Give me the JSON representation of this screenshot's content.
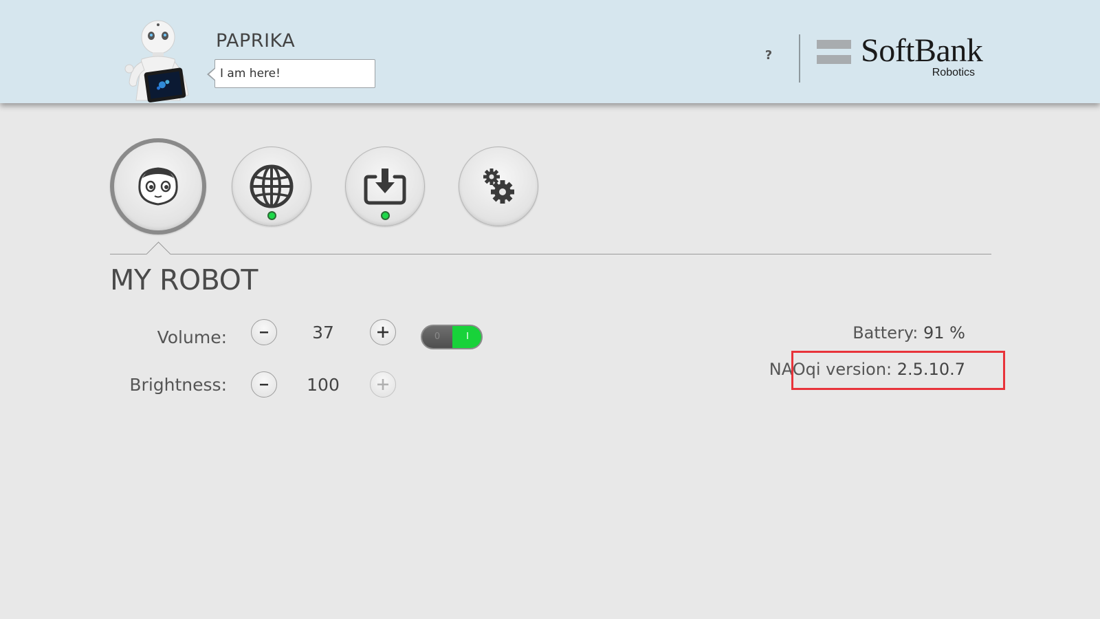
{
  "header": {
    "robot_name": "PAPRIKA",
    "speech_text": "I am here!",
    "help_label": "?",
    "brand_name": "SoftBank",
    "brand_sub": "Robotics"
  },
  "nav": {
    "tabs": [
      {
        "icon": "robot-face-icon",
        "active": true,
        "status": null
      },
      {
        "icon": "globe-icon",
        "active": false,
        "status": "online"
      },
      {
        "icon": "download-icon",
        "active": false,
        "status": "online"
      },
      {
        "icon": "gears-icon",
        "active": false,
        "status": null
      }
    ],
    "status_color": "#1ed84a"
  },
  "page": {
    "title": "MY ROBOT"
  },
  "controls": {
    "volume_label": "Volume:",
    "volume_value": "37",
    "volume_toggle_off": "0",
    "volume_toggle_on": "I",
    "brightness_label": "Brightness:",
    "brightness_value": "100"
  },
  "info": {
    "battery_label": "Battery:",
    "battery_value": "91 %",
    "naoqi_label": "NAOqi version:",
    "naoqi_value": "2.5.10.7"
  },
  "colors": {
    "header_bg": "#d6e6ee",
    "page_bg": "#e8e8e8",
    "toggle_on": "#18d23a",
    "highlight": "#e8333a"
  }
}
